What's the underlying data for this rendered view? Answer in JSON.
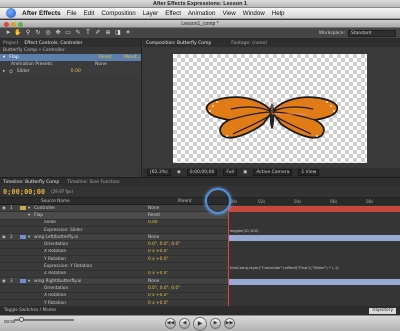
{
  "window": {
    "title": "After Effects Expressions: Lesson 1",
    "doc_title": "Lesson1_comp *"
  },
  "menubar": {
    "app": "After Effects",
    "items": [
      "File",
      "Edit",
      "Composition",
      "Layer",
      "Effect",
      "Animation",
      "View",
      "Window",
      "Help"
    ]
  },
  "toolbar": {
    "workspace_label": "Workspace:",
    "workspace_value": "Standard"
  },
  "left_panel": {
    "tabs": [
      "Project",
      "Effect Controls: Controller"
    ],
    "breadcrumb": "Butterfly Comp • Controller",
    "rows": [
      {
        "name": "Flap",
        "col2": "Reset",
        "col3": "About..."
      },
      {
        "name": "Animation Presets:",
        "col2": "None",
        "col3": ""
      },
      {
        "name": "Slider",
        "col2": "",
        "col3": "0.00"
      }
    ]
  },
  "comp_panel": {
    "tabs": [
      "Composition: Butterfly Comp",
      "Footage: (none)"
    ],
    "footer": {
      "zoom": "(62.3%)",
      "time": "0;00;00;00",
      "resolution": "Full",
      "camera": "Active Camera",
      "views": "1 View"
    }
  },
  "timeline": {
    "tabs": [
      "Timeline: Butterfly Comp",
      "Timeline: Sine Function"
    ],
    "timecode": "0;00;00;00",
    "fps": "(29.97 fps)",
    "col_source": "Source Name",
    "col_parent": "Parent",
    "ruler_labels": [
      "00s",
      "02s",
      "04s",
      "06s",
      "08s"
    ],
    "rows": [
      {
        "num": "1",
        "name": "Controller",
        "parent": "None",
        "color": "#c9a64b",
        "type": "layer"
      },
      {
        "num": "",
        "name": "Flap",
        "parent": "Reset",
        "color": "",
        "type": "sel"
      },
      {
        "num": "",
        "name": "Slider",
        "parent": "0.00",
        "color": "",
        "type": "prop"
      },
      {
        "num": "",
        "name": "Expression: Slider",
        "parent": "",
        "color": "",
        "type": "prop"
      },
      {
        "num": "2",
        "name": "wing Left/butterfly.ai",
        "parent": "None",
        "color": "#6f8fcf",
        "type": "layer"
      },
      {
        "num": "",
        "name": "Orientation",
        "parent": "0.0°, 0.0°, 0.0°",
        "color": "",
        "type": "prop"
      },
      {
        "num": "",
        "name": "X Rotation",
        "parent": "0 x +0.0°",
        "color": "",
        "type": "prop"
      },
      {
        "num": "",
        "name": "Y Rotation",
        "parent": "0 x +0.0°",
        "color": "",
        "type": "prop"
      },
      {
        "num": "",
        "name": "Expression: Y Rotation",
        "parent": "",
        "color": "",
        "type": "prop"
      },
      {
        "num": "",
        "name": "Z Rotation",
        "parent": "0 x +0.0°",
        "color": "",
        "type": "prop"
      },
      {
        "num": "3",
        "name": "wing Right/butterfly.ai",
        "parent": "None",
        "color": "#6f8fcf",
        "type": "layer"
      },
      {
        "num": "",
        "name": "Orientation",
        "parent": "0.0°, 0.0°, 0.0°",
        "color": "",
        "type": "prop"
      },
      {
        "num": "",
        "name": "X Rotation",
        "parent": "0 x +0.0°",
        "color": "",
        "type": "prop"
      },
      {
        "num": "",
        "name": "Y Rotation",
        "parent": "0 x +0.0°",
        "color": "",
        "type": "prop"
      },
      {
        "num": "",
        "name": "Expression: Y Rotation",
        "parent": "",
        "color": "",
        "type": "prop"
      },
      {
        "num": "",
        "name": "Z Rotation",
        "parent": "0 x +0.0°",
        "color": "",
        "type": "prop"
      }
    ],
    "expressions": [
      "wiggle(10,100)",
      "thisComp.layer(\"Controller\").effect(\"Flap\")(\"Slider\") * (-1)"
    ],
    "footer_left": "Toggle Switches / Modes",
    "footer_right": "Trajectory"
  },
  "player": {
    "time_elapsed": "00:00",
    "buttons": [
      "rewind",
      "back",
      "play",
      "forward",
      "end"
    ]
  }
}
